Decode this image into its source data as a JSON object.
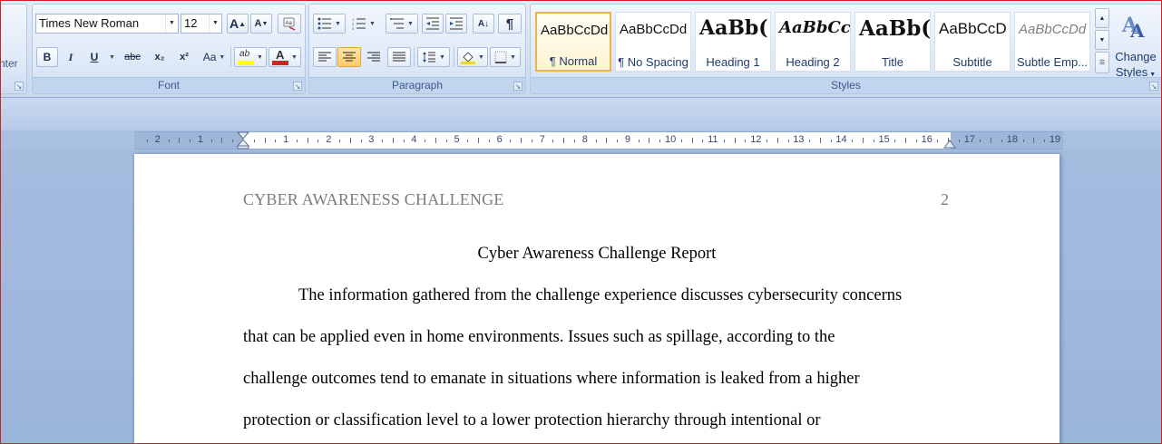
{
  "ribbon": {
    "clipboard_partial_label": "nter",
    "font": {
      "group_label": "Font",
      "font_name": "Times New Roman",
      "font_size": "12",
      "grow_label": "A",
      "shrink_label": "A",
      "bold": "B",
      "italic": "I",
      "underline": "U",
      "strikethrough": "abc",
      "subscript": "x₂",
      "superscript": "x²",
      "change_case": "Aa",
      "highlight_label": "ab",
      "font_color_label": "A",
      "highlight_color": "#ffff00",
      "font_color": "#e02020"
    },
    "paragraph": {
      "group_label": "Paragraph",
      "sort_label": "A↓",
      "show_marks": "¶"
    },
    "styles": {
      "group_label": "Styles",
      "items": [
        {
          "preview": "AaBbCcDd",
          "name": "¶ Normal"
        },
        {
          "preview": "AaBbCcDd",
          "name": "¶ No Spacing"
        },
        {
          "preview": "AaBb(",
          "name": "Heading 1"
        },
        {
          "preview": "AaBbCc",
          "name": "Heading 2"
        },
        {
          "preview": "AaBb(",
          "name": "Title"
        },
        {
          "preview": "AaBbCcD",
          "name": "Subtitle"
        },
        {
          "preview": "AaBbCcDd",
          "name": "Subtle Emp..."
        }
      ],
      "change_styles_line1": "Change",
      "change_styles_line2": "Styles"
    }
  },
  "ruler": {
    "left_numbers": [
      "2",
      "1"
    ],
    "right_numbers": [
      "1",
      "2",
      "3",
      "4",
      "5",
      "6",
      "7",
      "8",
      "9",
      "10",
      "11",
      "12",
      "13",
      "14",
      "15",
      "16",
      "17",
      "18",
      "19"
    ]
  },
  "document": {
    "header": "CYBER AWARENESS CHALLENGE",
    "page_number": "2",
    "title": "Cyber Awareness Challenge Report",
    "lines": [
      "The information gathered from the challenge experience discusses cybersecurity concerns",
      "that can be applied even in home environments. Issues such as spillage, according to the",
      "challenge outcomes tend to emanate in situations where information is leaked from a higher",
      "protection or classification level to a lower protection hierarchy through intentional or"
    ]
  },
  "colors": {
    "ribbon_accent": "#3b5a8c",
    "selected_style_border": "#e7b54e",
    "header_text": "#7b7b7b"
  }
}
